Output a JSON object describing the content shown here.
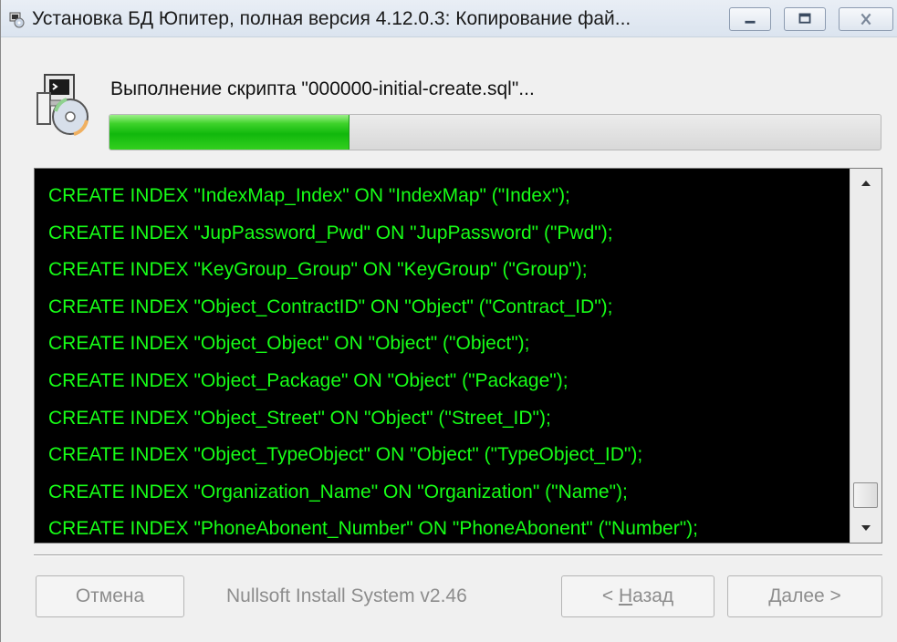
{
  "window": {
    "title": "Установка БД Юпитер, полная версия 4.12.0.3: Копирование фай...",
    "icon": "installer-icon"
  },
  "caption_buttons": [
    {
      "name": "minimize",
      "icon": "minimize-icon"
    },
    {
      "name": "maximize",
      "icon": "maximize-icon"
    },
    {
      "name": "close",
      "icon": "close-icon"
    }
  ],
  "header": {
    "icon": "installer-disk-icon",
    "status": "Выполнение скрипта \"000000-initial-create.sql\"..."
  },
  "progress": {
    "percent": 31,
    "color": "#11b80c"
  },
  "log": {
    "text_color": "#17ff17",
    "background": "#000000",
    "lines": [
      "CREATE INDEX \"IndexMap_Index\" ON \"IndexMap\" (\"Index\");",
      "CREATE INDEX \"JupPassword_Pwd\" ON \"JupPassword\" (\"Pwd\");",
      "CREATE INDEX \"KeyGroup_Group\" ON \"KeyGroup\" (\"Group\");",
      "CREATE INDEX \"Object_ContractID\" ON \"Object\" (\"Contract_ID\");",
      "CREATE INDEX \"Object_Object\" ON \"Object\" (\"Object\");",
      "CREATE INDEX \"Object_Package\" ON \"Object\" (\"Package\");",
      "CREATE INDEX \"Object_Street\" ON \"Object\" (\"Street_ID\");",
      "CREATE INDEX \"Object_TypeObject\" ON \"Object\" (\"TypeObject_ID\");",
      "CREATE INDEX \"Organization_Name\" ON \"Organization\" (\"Name\");",
      "CREATE INDEX \"PhoneAbonent_Number\" ON \"PhoneAbonent\" (\"Number\");"
    ]
  },
  "footer": {
    "cancel_label": "Отмена",
    "brand": "Nullsoft Install System v2.46",
    "back_prefix": "< ",
    "back_accel": "Н",
    "back_rest": "азад",
    "next_accel": "Д",
    "next_rest": "алее >"
  }
}
